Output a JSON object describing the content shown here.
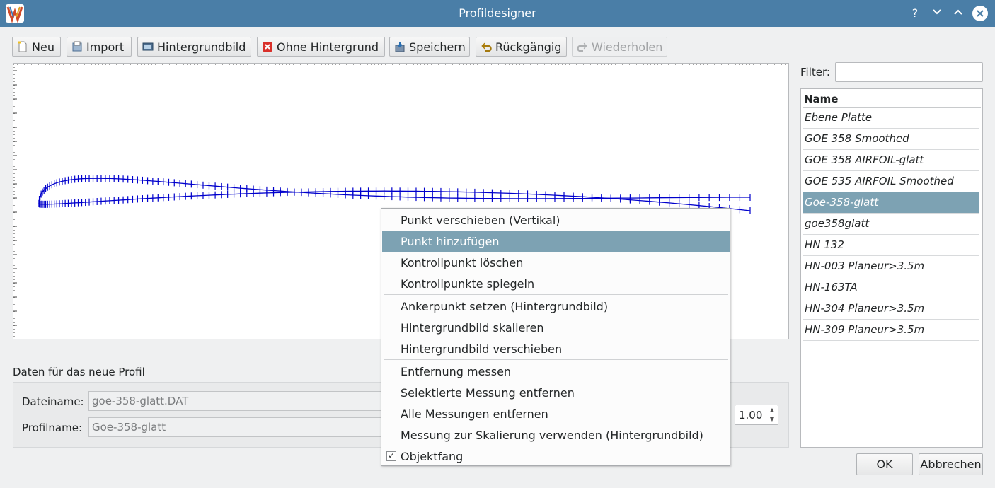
{
  "window": {
    "title": "Profildesigner",
    "controls": {
      "help": "?",
      "minimize": "⌄",
      "maximize": "⌃",
      "close": "✕"
    }
  },
  "toolbar": {
    "new_label": "Neu",
    "import_label": "Import",
    "background_label": "Hintergrundbild",
    "no_background_label": "Ohne Hintergrund",
    "save_label": "Speichern",
    "undo_label": "Rückgängig",
    "redo_label": "Wiederholen"
  },
  "form": {
    "group_title": "Daten für das neue Profil",
    "filename_label": "Dateiname:",
    "filename_value": "goe-358-glatt.DAT",
    "profilename_label": "Profilname:",
    "profilename_value": "Goe-358-glatt",
    "scale_value": "1.00"
  },
  "filter": {
    "label": "Filter:",
    "value": ""
  },
  "profile_list": {
    "header": "Name",
    "items": [
      "Ebene Platte",
      "GOE 358  Smoothed",
      "GOE 358 AIRFOIL-glatt",
      "GOE 535 AIRFOIL Smoothed",
      "Goe-358-glatt",
      "goe358glatt",
      "HN 132",
      "HN-003 Planeur>3.5m",
      "HN-163TA",
      "HN-304 Planeur>3.5m",
      "HN-309 Planeur>3.5m"
    ],
    "selected": "Goe-358-glatt"
  },
  "buttons": {
    "ok": "OK",
    "cancel": "Abbrechen"
  },
  "context_menu": {
    "items": [
      "Punkt verschieben (Vertikal)",
      "Punkt hinzufügen",
      "Kontrollpunkt löschen",
      "Kontrollpunkte spiegeln",
      "Ankerpunkt setzen (Hintergrundbild)",
      "Hintergrundbild skalieren",
      "Hintergrundbild verschieben",
      "Entfernung messen",
      "Selektierte Messung entfernen",
      "Alle Messungen entfernen",
      "Messung zur Skalierung verwenden (Hintergrundbild)",
      "Objektfang"
    ],
    "highlighted": "Punkt hinzufügen",
    "objektfang_checked": true
  },
  "colors": {
    "titlebar": "#4a7ea7",
    "selection": "#7da2b3",
    "profile_line": "#0000cc"
  },
  "icons": {
    "new": "new-document-icon",
    "import": "import-icon",
    "background": "image-icon",
    "no_background": "remove-icon",
    "save": "save-icon",
    "undo": "undo-icon",
    "redo": "redo-icon"
  }
}
